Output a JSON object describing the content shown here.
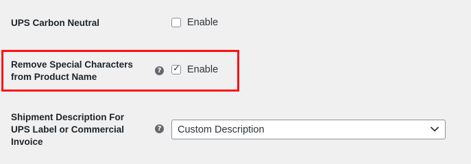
{
  "carbon_neutral": {
    "label": "UPS Carbon Neutral",
    "checkbox_label": "Enable",
    "checked": false
  },
  "remove_special_chars": {
    "label_line1": "Remove Special Characters",
    "label_line2": "from Product Name",
    "help_icon": "question-mark-icon",
    "checkbox_label": "Enable",
    "checked": true,
    "highlight_color": "#ff1010"
  },
  "shipment_description": {
    "label_line1": "Shipment Description For",
    "label_line2": "UPS Label or Commercial",
    "label_line3": "Invoice",
    "help_icon": "question-mark-icon",
    "selected_value": "Custom Description"
  }
}
